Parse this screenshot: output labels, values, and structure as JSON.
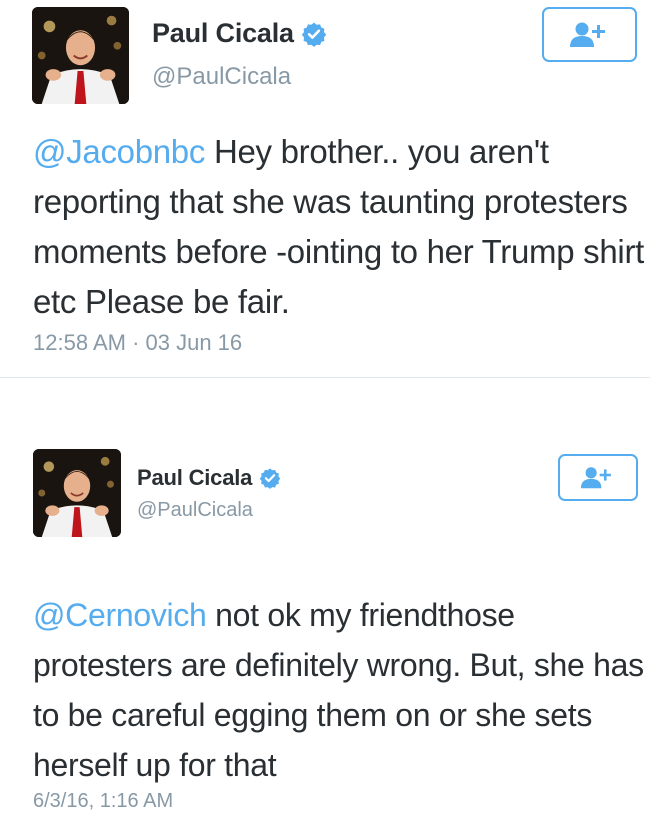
{
  "colors": {
    "link_blue": "#55acee",
    "text_dark": "#292f33",
    "meta_gray": "#8899a6",
    "divider": "#e1e8ed"
  },
  "tweets": [
    {
      "author_name": "Paul Cicala",
      "handle": "@PaulCicala",
      "verified_icon": "verified-badge-icon",
      "follow_icon": "follow-user-plus-icon",
      "mention": "@Jacobnbc",
      "text": " Hey brother.. you aren't reporting that she was taunting protesters moments before -ointing to her Trump shirt etc Please be fair.",
      "timestamp": "12:58 AM · 03 Jun 16"
    },
    {
      "author_name": "Paul Cicala",
      "handle": "@PaulCicala",
      "verified_icon": "verified-badge-icon",
      "follow_icon": "follow-user-plus-icon",
      "mention": "@Cernovich",
      "text": " not ok my friendthose protesters are definitely wrong. But, she has to be careful egging them on or she sets herself up for that",
      "timestamp": "6/3/16, 1:16 AM"
    }
  ]
}
